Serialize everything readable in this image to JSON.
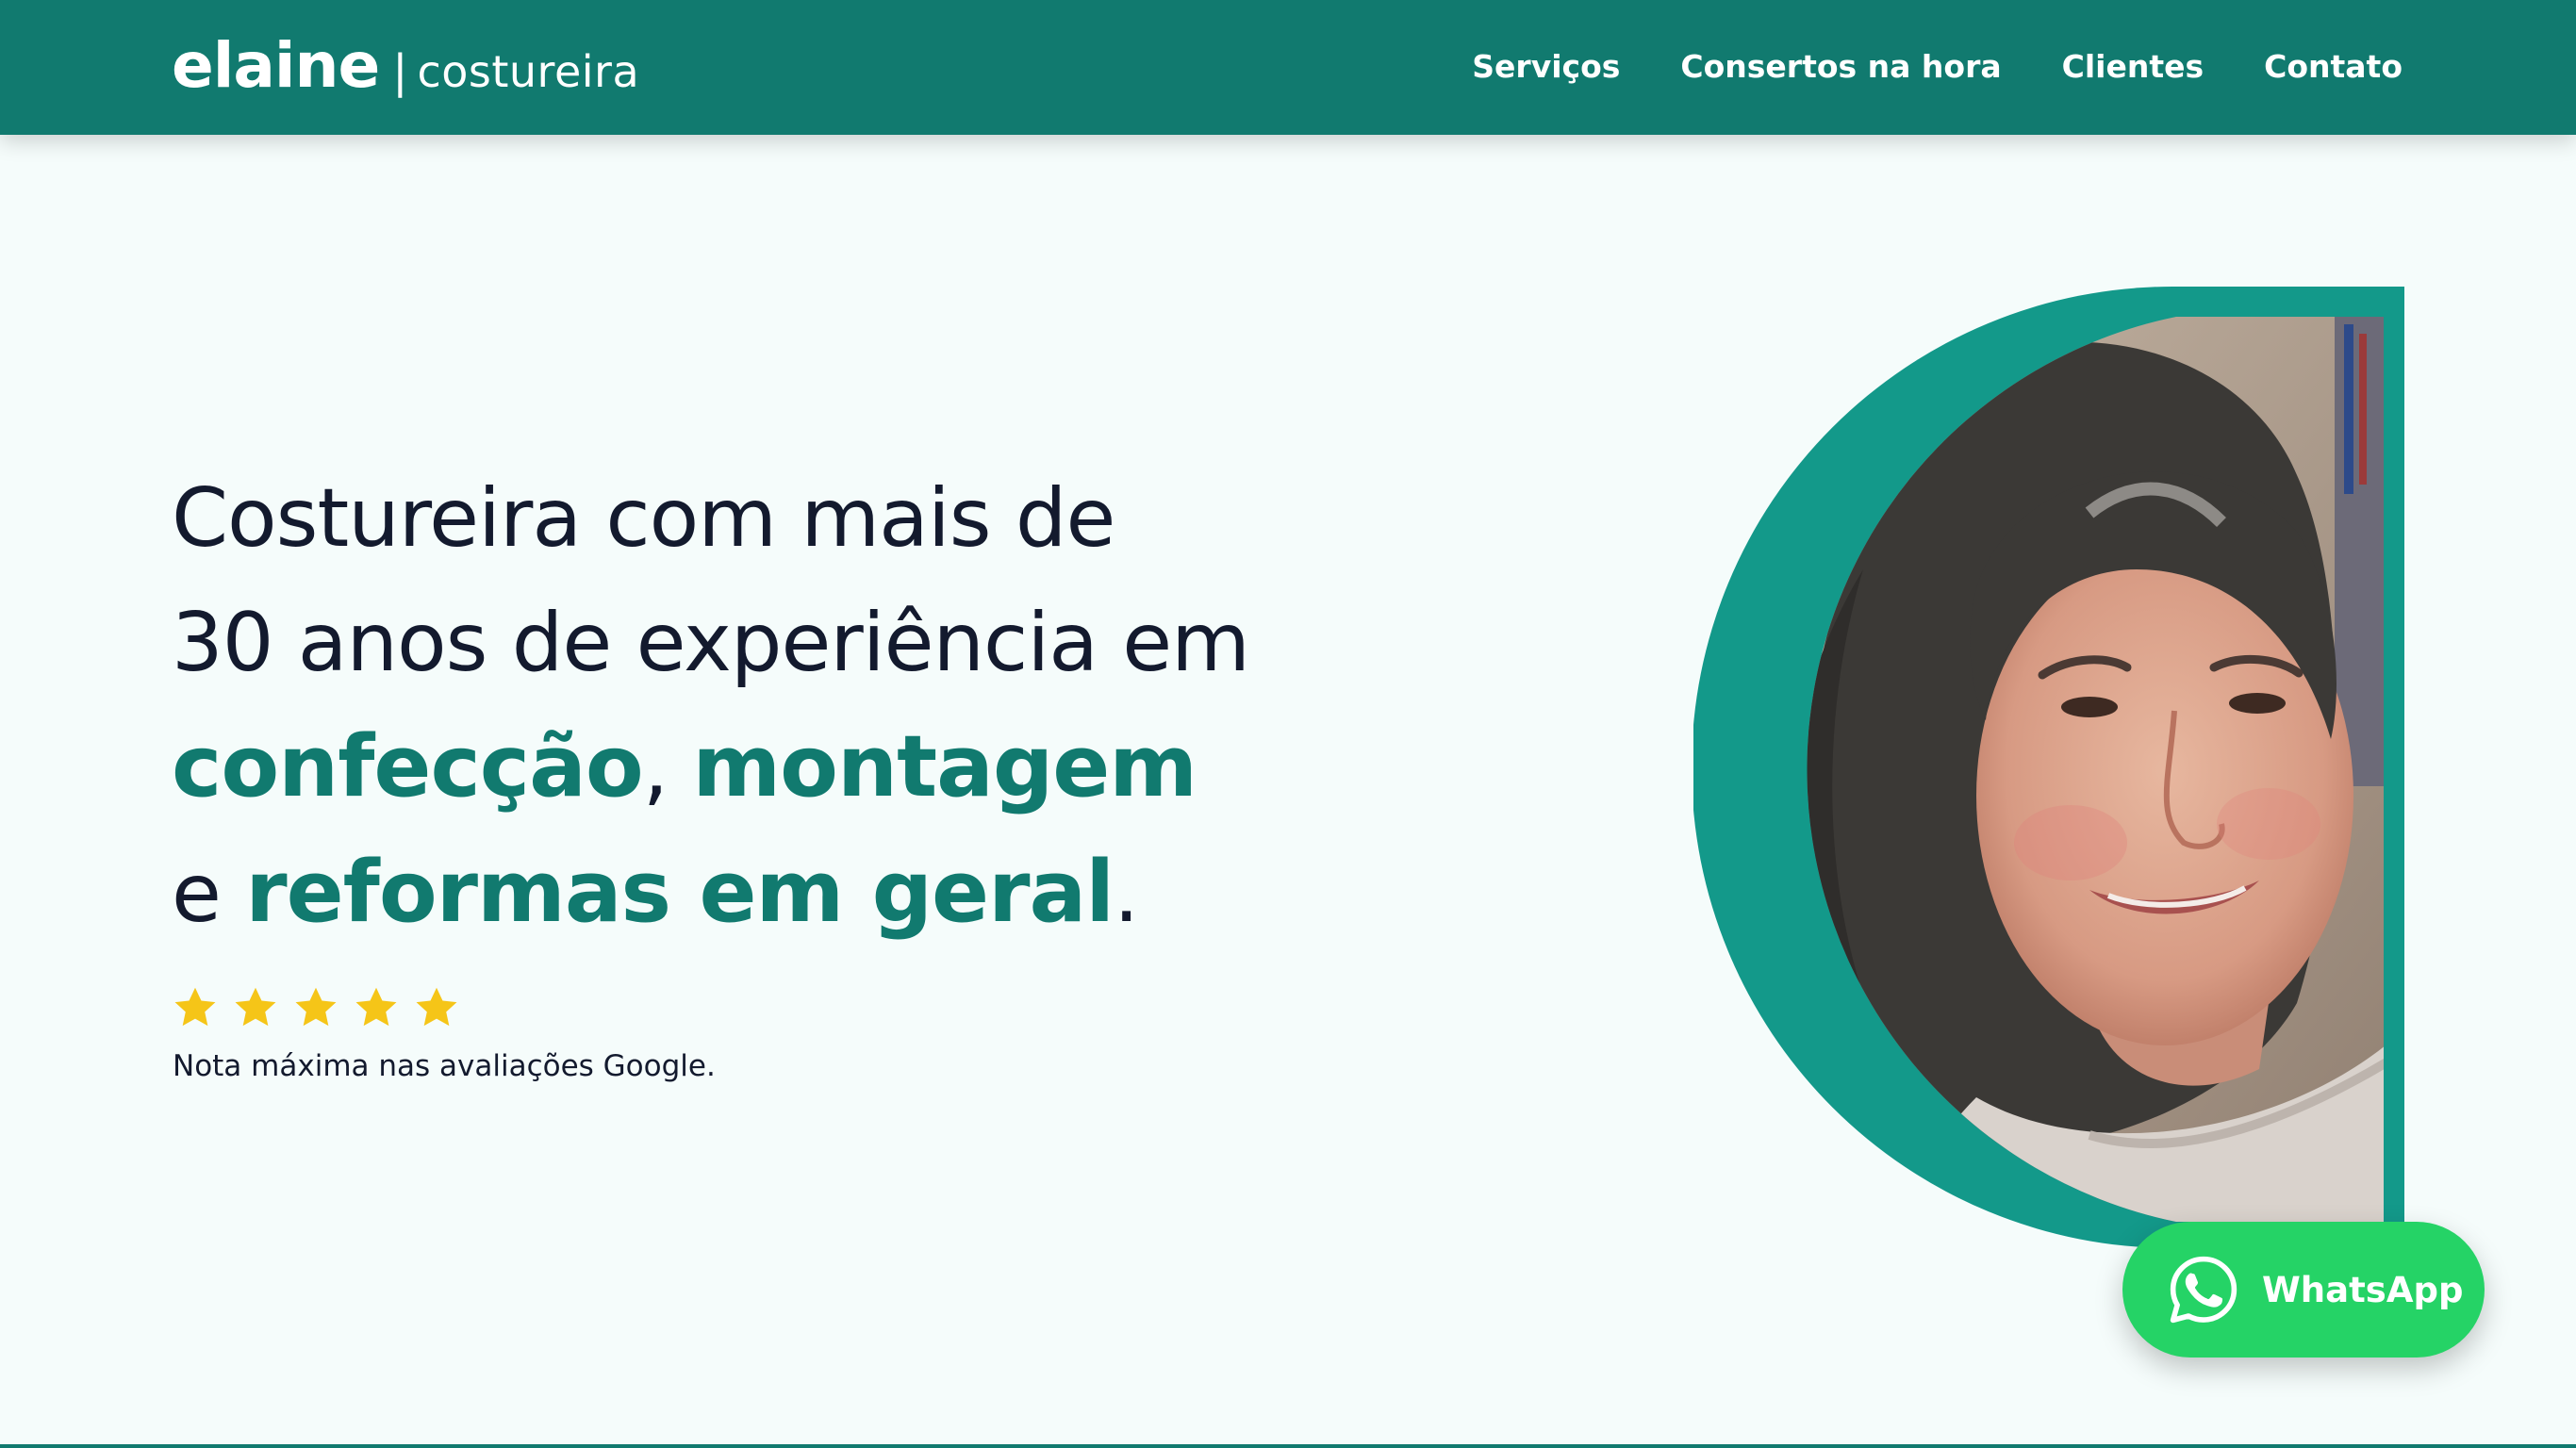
{
  "colors": {
    "brand": "#117a6f",
    "text": "#131a2e",
    "background": "#f5fcfb",
    "star": "#f5c518",
    "whatsapp": "#25d366",
    "portrait_ring": "#13998a"
  },
  "header": {
    "brand_name": "elaine",
    "brand_separator": "|",
    "brand_subtitle": "costureira",
    "nav": [
      {
        "label": "Serviços"
      },
      {
        "label": "Consertos na hora"
      },
      {
        "label": "Clientes"
      },
      {
        "label": "Contato"
      }
    ]
  },
  "hero": {
    "line1": "Costureira com mais de",
    "line2": "30 anos de experiência em",
    "line3": {
      "hl1": "confecção",
      "sep": ", ",
      "hl2": "montagem"
    },
    "line4": {
      "pre": "e ",
      "hl": "reformas em geral",
      "post": "."
    },
    "rating": {
      "stars": 5,
      "max": 5,
      "icon": "star-icon",
      "note": "Nota máxima nas avaliações Google."
    },
    "portrait": {
      "icon": "portrait-photo"
    }
  },
  "whatsapp": {
    "label": "WhatsApp",
    "icon": "whatsapp-icon"
  }
}
